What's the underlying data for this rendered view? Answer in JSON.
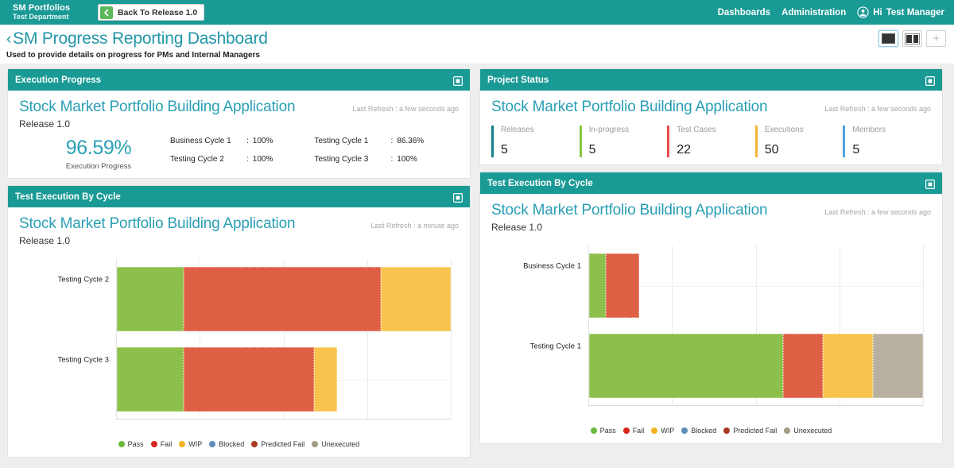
{
  "topbar": {
    "brand_title": "SM Portfolios",
    "brand_sub": "Test Department",
    "back_button": "Back To Release 1.0",
    "back_icon": "arrow-left-icon",
    "nav": [
      {
        "label": "Dashboards"
      },
      {
        "label": "Administration"
      }
    ],
    "user_icon": "user-circle-icon",
    "greeting": "Hi",
    "user_name": "Test Manager",
    "bg_color": "#1a9a95"
  },
  "page": {
    "back_chevron": "‹",
    "title": "SM Progress Reporting Dashboard",
    "subtitle": "Used to provide details on progress for PMs and Internal Managers",
    "title_color": "#2296a8",
    "layout_buttons": [
      {
        "name": "layout-one-column",
        "selected": true
      },
      {
        "name": "layout-two-column",
        "selected": false
      },
      {
        "name": "add-widget",
        "label": "+"
      }
    ]
  },
  "panels": {
    "execution_progress": {
      "header": "Execution Progress",
      "app_title": "Stock Market Portfolio Building Application",
      "release": "Release 1.0",
      "refresh": "Last Refresh : a few seconds ago",
      "percent": "96.59%",
      "percent_caption": "Execution Progress",
      "cycles": [
        {
          "name": "Business Cycle 1",
          "sep": ":",
          "value": "100%"
        },
        {
          "name": "Testing Cycle 2",
          "sep": ":",
          "value": "100%"
        },
        {
          "name": "Testing Cycle 1",
          "sep": ":",
          "value": "86.36%"
        },
        {
          "name": "Testing Cycle 3",
          "sep": ":",
          "value": "100%"
        }
      ]
    },
    "project_status": {
      "header": "Project Status",
      "app_title": "Stock Market Portfolio Building Application",
      "refresh": "Last Refresh : a few seconds ago",
      "stats": [
        {
          "label": "Releases",
          "value": "5",
          "color": "#15808c"
        },
        {
          "label": "In-progress",
          "value": "5",
          "color": "#8ac342"
        },
        {
          "label": "Test Cases",
          "value": "22",
          "color": "#ef4b4b"
        },
        {
          "label": "Executions",
          "value": "50",
          "color": "#f5b335"
        },
        {
          "label": "Members",
          "value": "5",
          "color": "#4aa3df"
        }
      ]
    },
    "test_execution_left": {
      "header": "Test Execution By Cycle",
      "app_title": "Stock Market Portfolio Building Application",
      "release": "Release 1.0",
      "refresh": "Last Refresh : a minute ago"
    },
    "test_execution_right": {
      "header": "Test Execution By Cycle",
      "app_title": "Stock Market Portfolio Building Application",
      "release": "Release 1.0",
      "refresh": "Last Refresh : a few seconds ago"
    }
  },
  "legend": [
    {
      "label": "Pass",
      "color": "#6aba3f"
    },
    {
      "label": "Fail",
      "color": "#d9261c"
    },
    {
      "label": "WIP",
      "color": "#f5b323"
    },
    {
      "label": "Blocked",
      "color": "#5b8fb9"
    },
    {
      "label": "Predicted Fail",
      "color": "#a83a21"
    },
    {
      "label": "Unexecuted",
      "color": "#a39b86"
    }
  ],
  "series_colors": {
    "pass": "#8dc04a",
    "fail": "#df5f45",
    "wip": "#f8c košice",
    "wip_hex": "#f8c44e",
    "blocked": "#5b8fb9",
    "predicted_fail": "#a83a21",
    "unexecuted": "#b8b1a0"
  },
  "chart_data": [
    {
      "id": "test-execution-by-cycle-left",
      "type": "bar",
      "orientation": "horizontal",
      "stacked": true,
      "title": "Test Execution By Cycle",
      "categories": [
        "Testing Cycle 2",
        "Testing Cycle 3"
      ],
      "series": [
        {
          "name": "Pass",
          "color": "#8dc04a",
          "values": [
            20,
            20
          ]
        },
        {
          "name": "Fail",
          "color": "#df5f45",
          "values": [
            59,
            39
          ]
        },
        {
          "name": "WIP",
          "color": "#f8c44e",
          "values": [
            21,
            7
          ]
        },
        {
          "name": "Blocked",
          "color": "#5b8fb9",
          "values": [
            0,
            0
          ]
        },
        {
          "name": "Predicted Fail",
          "color": "#a83a21",
          "values": [
            0,
            0
          ]
        },
        {
          "name": "Unexecuted",
          "color": "#b8b1a0",
          "values": [
            0,
            0
          ]
        }
      ],
      "xlim": [
        0,
        100
      ],
      "grid": true,
      "legend_position": "bottom"
    },
    {
      "id": "test-execution-by-cycle-right",
      "type": "bar",
      "orientation": "horizontal",
      "stacked": true,
      "title": "Test Execution By Cycle",
      "categories": [
        "Business Cycle 1",
        "Testing Cycle 1"
      ],
      "series": [
        {
          "name": "Pass",
          "color": "#8dc04a",
          "values": [
            5,
            58
          ]
        },
        {
          "name": "Fail",
          "color": "#df5f45",
          "values": [
            10,
            12
          ]
        },
        {
          "name": "WIP",
          "color": "#f8c44e",
          "values": [
            0,
            15
          ]
        },
        {
          "name": "Blocked",
          "color": "#5b8fb9",
          "values": [
            0,
            0
          ]
        },
        {
          "name": "Predicted Fail",
          "color": "#a83a21",
          "values": [
            0,
            0
          ]
        },
        {
          "name": "Unexecuted",
          "color": "#b8b1a0",
          "values": [
            0,
            15
          ]
        }
      ],
      "xlim": [
        0,
        100
      ],
      "grid": true,
      "legend_position": "bottom"
    }
  ]
}
